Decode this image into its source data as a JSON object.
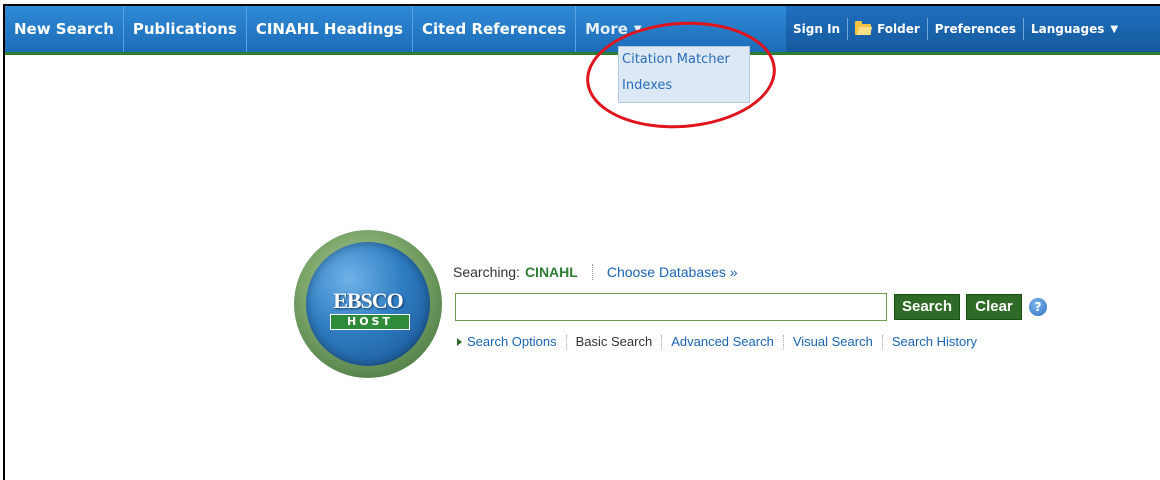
{
  "nav": {
    "items": [
      {
        "label": "New Search"
      },
      {
        "label": "Publications"
      },
      {
        "label": "CINAHL Headings"
      },
      {
        "label": "Cited References"
      }
    ],
    "more_label": "More"
  },
  "nav_right": {
    "sign_in": "Sign In",
    "folder": "Folder",
    "preferences": "Preferences",
    "languages": "Languages"
  },
  "more_menu": {
    "items": [
      {
        "label": "Citation Matcher"
      },
      {
        "label": "Indexes"
      }
    ]
  },
  "logo": {
    "ebsco": "EBSCO",
    "host": "HOST"
  },
  "search": {
    "searching_label": "Searching:",
    "database": "CINAHL",
    "choose_databases": "Choose Databases »",
    "query": "",
    "search_button": "Search",
    "clear_button": "Clear",
    "help": "?"
  },
  "options": {
    "search_options": "Search Options",
    "basic_search": "Basic Search",
    "advanced_search": "Advanced Search",
    "visual_search": "Visual Search",
    "search_history": "Search History"
  },
  "colors": {
    "nav_blue": "#1c6cb8",
    "accent_green": "#2e6b26",
    "link_blue": "#1a64b3",
    "annotation_red": "#e0141c"
  }
}
